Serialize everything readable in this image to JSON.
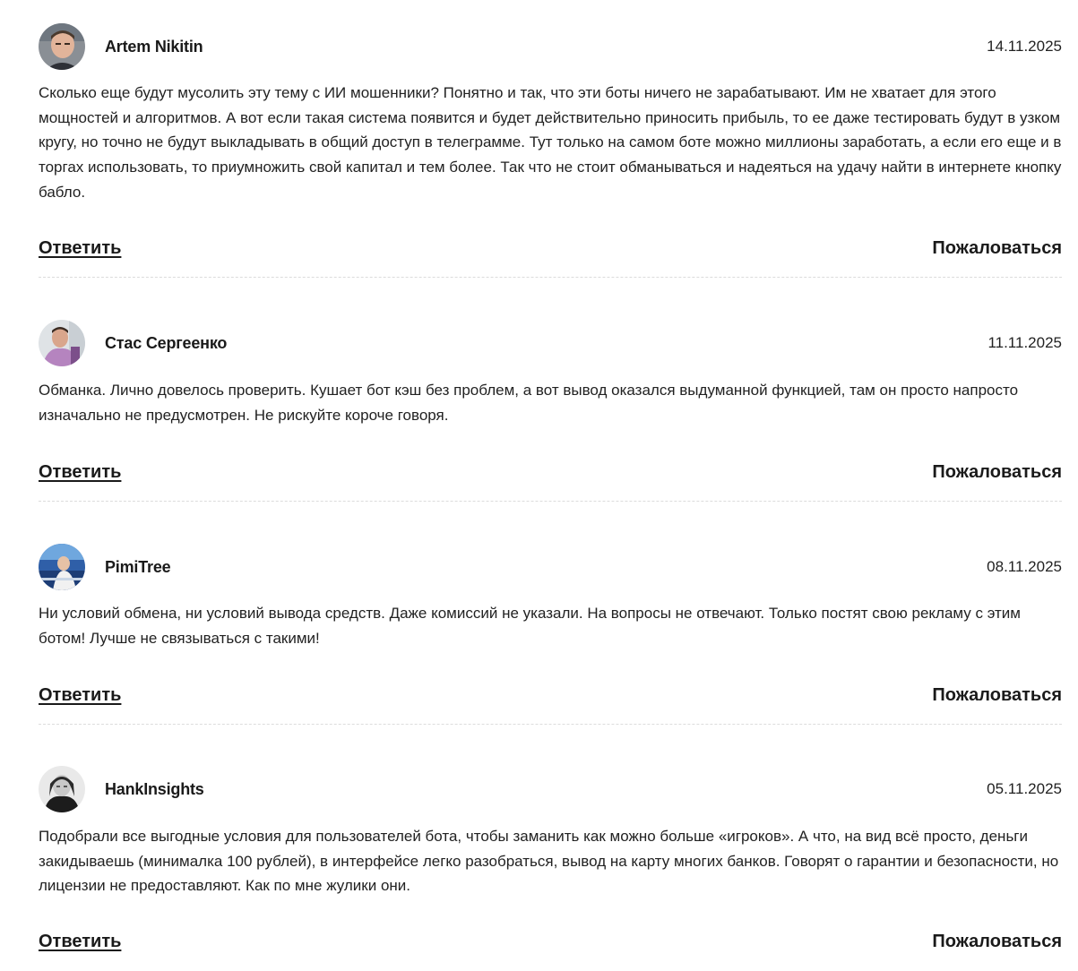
{
  "comments": [
    {
      "author": "Artem Nikitin",
      "date": "14.11.2025",
      "avatar_icon": "user-photo-avatar",
      "text": "Сколько еще будут мусолить эту тему с ИИ мошенники? Понятно и так, что эти боты ничего не зарабатывают. Им не хватает для этого мощностей и алгоритмов. А вот если такая система появится и будет действительно приносить прибыль, то ее даже тестировать будут в узком кругу, но точно не будут выкладывать в общий доступ в телеграмме. Тут только на самом боте можно миллионы заработать, а если его еще и в торгах использовать, то приумножить свой капитал и тем более. Так что не стоит обманываться и надеяться на удачу найти в интернете кнопку бабло.",
      "reply_label": "Ответить",
      "report_label": "Пожаловаться"
    },
    {
      "author": "Стас Сергеенко",
      "date": "11.11.2025",
      "avatar_icon": "user-photo-avatar",
      "text": "Обманка. Лично довелось проверить. Кушает бот кэш без проблем, а вот вывод оказался выдуманной функцией, там он просто напросто изначально не предусмотрен. Не рискуйте короче говоря.",
      "reply_label": "Ответить",
      "report_label": "Пожаловаться"
    },
    {
      "author": "PimiTree",
      "date": "08.11.2025",
      "avatar_icon": "user-photo-avatar",
      "text": "Ни условий обмена, ни условий вывода средств. Даже комиссий не указали. На вопросы не отвечают. Только постят свою рекламу с этим ботом! Лучше не связываться с такими!",
      "reply_label": "Ответить",
      "report_label": "Пожаловаться"
    },
    {
      "author": "HankInsights",
      "date": "05.11.2025",
      "avatar_icon": "user-photo-avatar",
      "text": "Подобрали все выгодные условия для пользователей бота, чтобы заманить как можно больше «игроков». А что, на вид всё просто, деньги закидываешь (минималка 100 рублей), в интерфейсе легко разобраться, вывод на карту многих банков. Говорят о гарантии и безопасности, но лицензии не предоставляют. Как по мне жулики они.",
      "reply_label": "Ответить",
      "report_label": "Пожаловаться"
    }
  ]
}
